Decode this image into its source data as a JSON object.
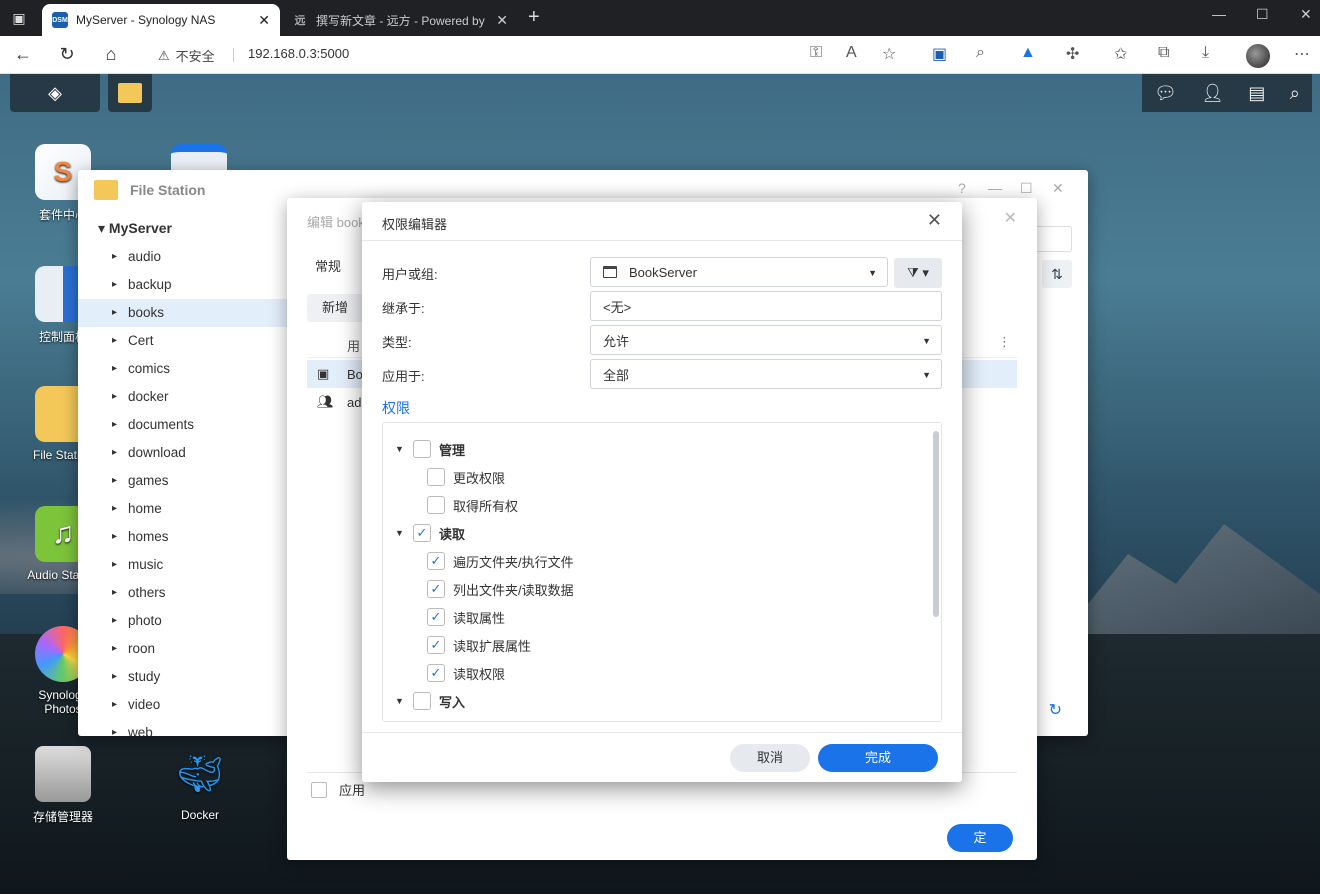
{
  "browser": {
    "tabs": [
      {
        "label": "MyServer - Synology NAS",
        "favicon": "DSM"
      },
      {
        "label": "撰写新文章 - 远方 - Powered by",
        "favicon": "远"
      }
    ],
    "security_label": "不安全",
    "url": "192.168.0.3:5000"
  },
  "desktop": {
    "icons": [
      {
        "label": "套件中心"
      },
      {
        "label": "控制面板"
      },
      {
        "label": "File Station"
      },
      {
        "label": "Audio Station"
      },
      {
        "label": "Synology Photos"
      },
      {
        "label": "存储管理器"
      },
      {
        "label": "Docker"
      }
    ]
  },
  "file_station": {
    "title": "File Station",
    "root": "MyServer",
    "folders": [
      "audio",
      "backup",
      "books",
      "Cert",
      "comics",
      "docker",
      "documents",
      "download",
      "games",
      "home",
      "homes",
      "music",
      "others",
      "photo",
      "roon",
      "study",
      "video",
      "web"
    ],
    "selected": "books"
  },
  "edit_dialog": {
    "title": "编辑 books",
    "tab": "常规",
    "new_button": "新增",
    "column_user": "用",
    "rows": [
      {
        "name": "BookServer",
        "icon": "calendar-icon"
      },
      {
        "name": "admin",
        "icon": "users-icon"
      }
    ],
    "apply_label": "应用"
  },
  "perm_editor": {
    "title": "权限编辑器",
    "user_label": "用户或组:",
    "user_value": "BookServer",
    "inherit_label": "继承于:",
    "inherit_value": "<无>",
    "type_label": "类型:",
    "type_value": "允许",
    "apply_label": "应用于:",
    "apply_value": "全部",
    "perm_link": "权限",
    "tree": [
      {
        "label": "管理",
        "level": 0,
        "checked": false,
        "group": true
      },
      {
        "label": "更改权限",
        "level": 1,
        "checked": false
      },
      {
        "label": "取得所有权",
        "level": 1,
        "checked": false
      },
      {
        "label": "读取",
        "level": 0,
        "checked": true,
        "group": true
      },
      {
        "label": "遍历文件夹/执行文件",
        "level": 1,
        "checked": true
      },
      {
        "label": "列出文件夹/读取数据",
        "level": 1,
        "checked": true
      },
      {
        "label": "读取属性",
        "level": 1,
        "checked": true
      },
      {
        "label": "读取扩展属性",
        "level": 1,
        "checked": true
      },
      {
        "label": "读取权限",
        "level": 1,
        "checked": true
      },
      {
        "label": "写入",
        "level": 0,
        "checked": false,
        "group": true
      }
    ],
    "cancel": "取消",
    "done": "完成"
  },
  "colors": {
    "accent": "#1a73e8"
  }
}
